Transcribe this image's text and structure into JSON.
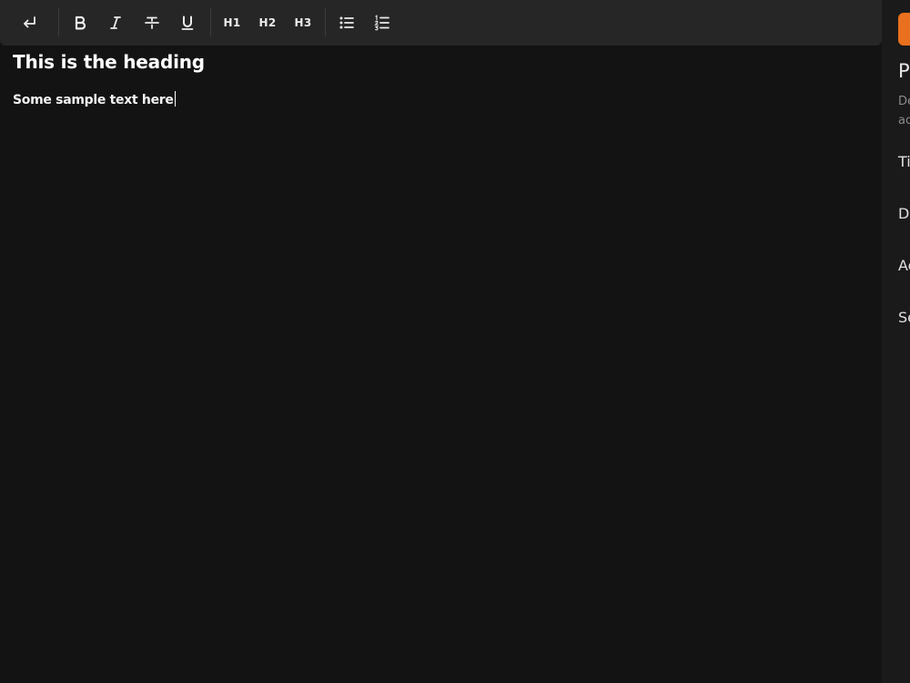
{
  "toolbar": {
    "buttons": [
      {
        "name": "undo",
        "icon": "undo-arrow-icon"
      },
      {
        "name": "bold",
        "icon": "bold-icon",
        "label": "B"
      },
      {
        "name": "italic",
        "icon": "italic-icon",
        "label": "I"
      },
      {
        "name": "strikethrough",
        "icon": "strikethrough-icon"
      },
      {
        "name": "underline",
        "icon": "underline-icon",
        "label": "U"
      },
      {
        "name": "heading-1",
        "label": "H1"
      },
      {
        "name": "heading-2",
        "label": "H2"
      },
      {
        "name": "heading-3",
        "label": "H3"
      },
      {
        "name": "bullet-list",
        "icon": "bullet-list-icon"
      },
      {
        "name": "numbered-list",
        "icon": "numbered-list-icon"
      }
    ]
  },
  "document": {
    "heading": "This is the heading",
    "paragraph": "Some sample text here"
  },
  "side_panel": {
    "title": "P",
    "description_lines": [
      "De",
      "ac"
    ],
    "fields": [
      "Ti",
      "Da",
      "Ac",
      "Se"
    ]
  },
  "colors": {
    "background": "#131313",
    "toolbar": "#262626",
    "panel": "#1a1a1a",
    "accent": "#e8701e",
    "text": "#ffffff"
  }
}
